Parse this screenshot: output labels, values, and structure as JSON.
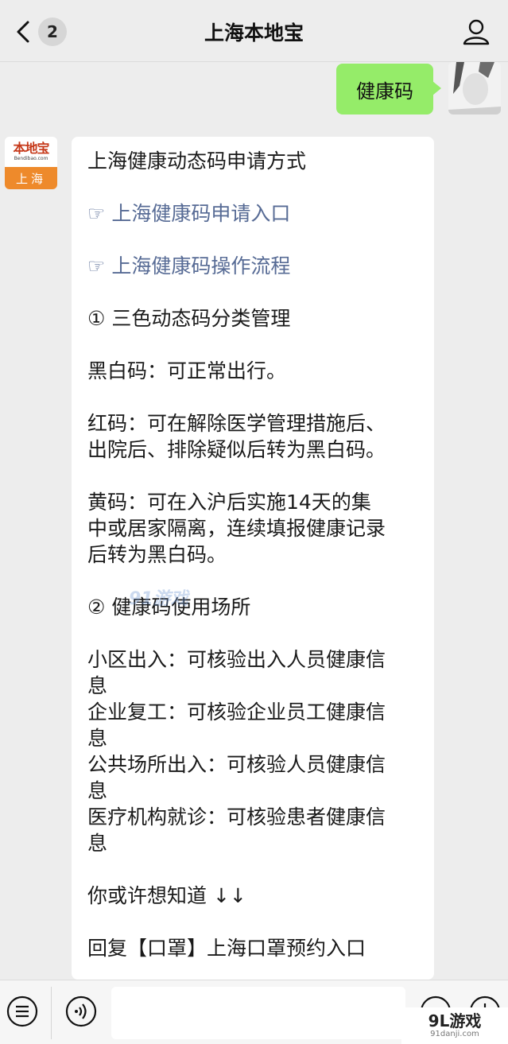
{
  "header": {
    "title": "上海本地宝",
    "unread_count": "2"
  },
  "outgoing": {
    "text": "健康码"
  },
  "bot": {
    "logo_brand": "本地宝",
    "logo_sub": "Bendibao.com",
    "logo_city": "上海"
  },
  "message": {
    "title": "上海健康动态码申请方式",
    "link1": "☞ 上海健康码申请入口",
    "link2": "☞ 上海健康码操作流程",
    "section1": "① 三色动态码分类管理",
    "black_white": "黑白码：可正常出行。",
    "red_line1": "红码：可在解除医学管理措施后、",
    "red_line2": "出院后、排除疑似后转为黑白码。",
    "yellow_line1": "黄码：可在入沪后实施14天的集",
    "yellow_line2": "中或居家隔离，连续填报健康记录",
    "yellow_line3": "后转为黑白码。",
    "section2": "② 健康码使用场所",
    "place1_line1": "小区出入：可核验出入人员健康信",
    "place1_line2": "息",
    "place2_line1": "企业复工：可核验企业员工健康信",
    "place2_line2": "息",
    "place3_line1": "公共场所出入：可核验人员健康信",
    "place3_line2": "息",
    "place4_line1": "医疗机构就诊：可核验患者健康信",
    "place4_line2": "息",
    "more": "你或许想知道 ↓↓",
    "reply": "回复【口罩】上海口罩预约入口"
  },
  "watermark": {
    "mid": "91游戏",
    "corner_brand": "9L游戏",
    "corner_url": "91danji.com"
  },
  "icons": {
    "back": "chevron-left-icon",
    "user": "user-icon",
    "menu": "menu-icon",
    "voice": "voice-icon",
    "emoji": "emoji-icon",
    "plus": "plus-icon"
  }
}
